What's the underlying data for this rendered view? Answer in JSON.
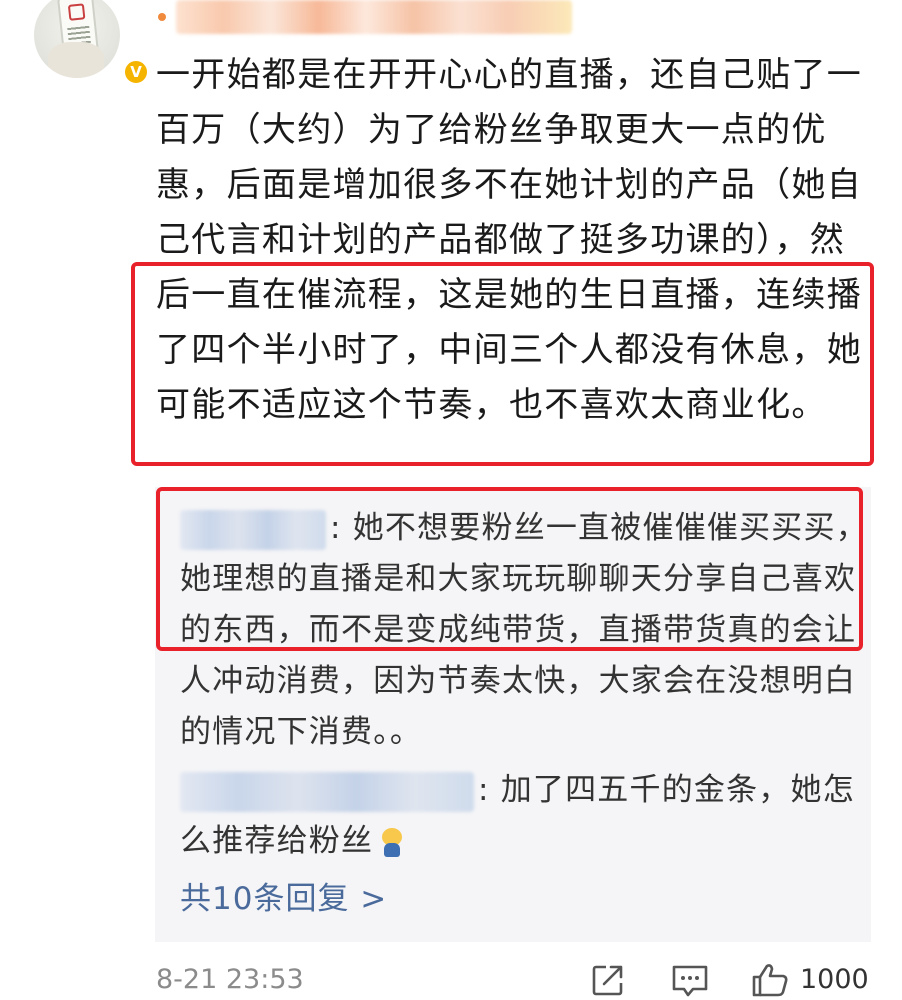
{
  "post": {
    "username_obscured": true,
    "comment": "一开始都是在开开心心的直播，还自己贴了一百万（大约）为了给粉丝争取更大一点的优惠，后面是增加很多不在她计划的产品（她自己代言和计划的产品都做了挺多功课的），然后一直在催流程，这是她的生日直播，连续播了四个半小时了，中间三个人都没有休息，她可能不适应这个节奏，也不喜欢太商业化。"
  },
  "replies": [
    {
      "name_obscured": true,
      "text": ": 她不想要粉丝一直被催催催买买买，她理想的直播是和大家玩玩聊聊天分享自己喜欢的东西，而不是变成纯带货，直播带货真的会让人冲动消费，因为节奏太快，大家会在没想明白的情况下消费。。"
    },
    {
      "name_obscured": true,
      "text": ": 加了四五千的金条，她怎么推荐给粉丝",
      "emoji": "kneeling-emoji"
    }
  ],
  "more_replies_label": "共10条回复 >",
  "footer": {
    "timestamp": "8-21 23:53",
    "like_count": "1000"
  },
  "colors": {
    "highlight_border": "#e8212a",
    "link": "#4a6a9b",
    "verified_badge": "#f5b400",
    "reply_background": "#f5f5f7"
  },
  "icons": [
    "verified-v-icon",
    "share-icon",
    "comment-icon",
    "like-thumb-icon"
  ]
}
